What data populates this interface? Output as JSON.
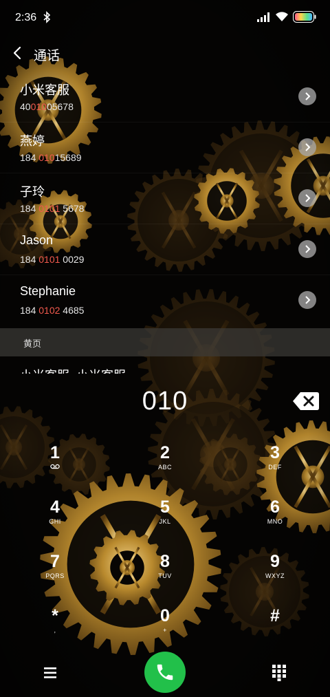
{
  "status_bar": {
    "time": "2:36",
    "icons": [
      "bluetooth-icon",
      "signal-icon",
      "wifi-icon",
      "battery-icon"
    ]
  },
  "header": {
    "back_icon": "chevron-left-icon",
    "title": "通话"
  },
  "contacts": [
    {
      "name": "小米客服",
      "number_prefix": "40",
      "number_match": "010",
      "number_suffix": "05678"
    },
    {
      "name": "燕婷",
      "number_prefix": "184 ",
      "number_match": "010",
      "number_suffix": "15689"
    },
    {
      "name": "子玲",
      "number_prefix": "184 ",
      "number_match": "0101",
      "number_suffix": " 5678"
    },
    {
      "name": "Jason",
      "number_prefix": "184 ",
      "number_match": "0101",
      "number_suffix": " 0029"
    },
    {
      "name": "Stephanie",
      "number_prefix": "184 ",
      "number_match": "0102",
      "number_suffix": " 4685"
    }
  ],
  "yellow_pages": {
    "label": "黄页",
    "partial_item": "小米客服  小米客服"
  },
  "dialer": {
    "number": "010",
    "backspace_icon": "backspace-icon"
  },
  "keypad": [
    {
      "digit": "1",
      "letters": "voicemail"
    },
    {
      "digit": "2",
      "letters": "ABC"
    },
    {
      "digit": "3",
      "letters": "DEF"
    },
    {
      "digit": "4",
      "letters": "GHI"
    },
    {
      "digit": "5",
      "letters": "JKL"
    },
    {
      "digit": "6",
      "letters": "MNO"
    },
    {
      "digit": "7",
      "letters": "PQRS"
    },
    {
      "digit": "8",
      "letters": "TUV"
    },
    {
      "digit": "9",
      "letters": "WXYZ"
    },
    {
      "digit": "*",
      "letters": ","
    },
    {
      "digit": "0",
      "letters": "+"
    },
    {
      "digit": "#",
      "letters": ""
    }
  ],
  "bottom_bar": {
    "menu_icon": "menu-icon",
    "call_icon": "phone-icon",
    "keypad_icon": "dialpad-icon"
  },
  "colors": {
    "match_highlight": "#f25a4e",
    "call_button": "#22c04a",
    "gear_gold": "#b98a2e"
  }
}
